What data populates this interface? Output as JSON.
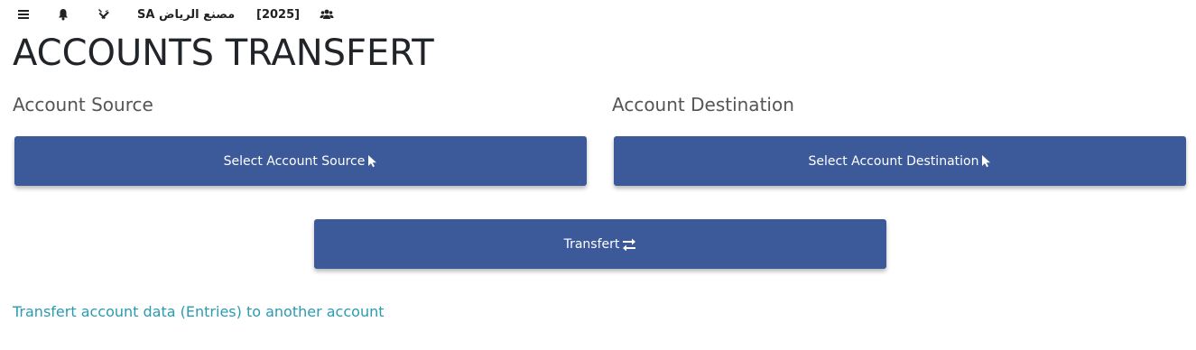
{
  "topbar": {
    "menu_icon": "menu-icon",
    "bell_icon": "bell-icon",
    "tools_icon": "tools-icon",
    "company_name": "مصنع الرياض SA",
    "year": "[2025]",
    "users_icon": "users-icon"
  },
  "page": {
    "title": "ACCOUNTS TRANSFERT"
  },
  "source": {
    "label": "Account Source",
    "button_label": "Select Account Source",
    "button_icon": "pointer-icon"
  },
  "destination": {
    "label": "Account Destination",
    "button_label": "Select Account Destination",
    "button_icon": "pointer-icon"
  },
  "transfer": {
    "button_label": "Transfert",
    "button_icon": "exchange-icon"
  },
  "footer": {
    "link_text": "Transfert account data (Entries) to another account"
  },
  "colors": {
    "button_bg": "#3c5a9a",
    "link": "#2a9bb0"
  }
}
